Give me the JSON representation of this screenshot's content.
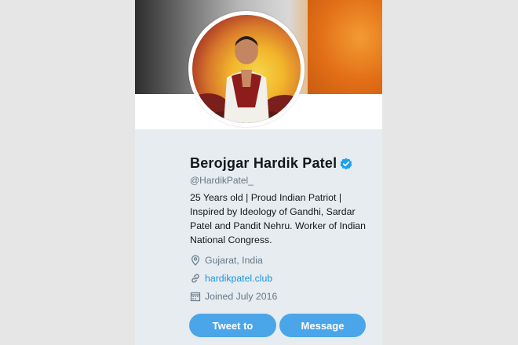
{
  "profile": {
    "name": "Berojgar Hardik Patel",
    "handle": "@HardikPatel_",
    "bio": "25 Years old | Proud Indian Patriot | Inspired by Ideology of Gandhi, Sardar Patel and Pandit Nehru. Worker of Indian National Congress.",
    "location": "Gujarat, India",
    "website": "hardikpatel.club",
    "joined": "Joined July 2016",
    "verified": true
  },
  "actions": {
    "tweet_to": "Tweet to",
    "message": "Message"
  },
  "icons": {
    "verified": "verified-badge-icon",
    "location": "location-pin-icon",
    "website": "link-icon",
    "joined": "calendar-icon"
  },
  "colors": {
    "accent": "#1da1f2",
    "link": "#1b95e0",
    "button": "#4aa6e8",
    "secondary_text": "#657786"
  }
}
